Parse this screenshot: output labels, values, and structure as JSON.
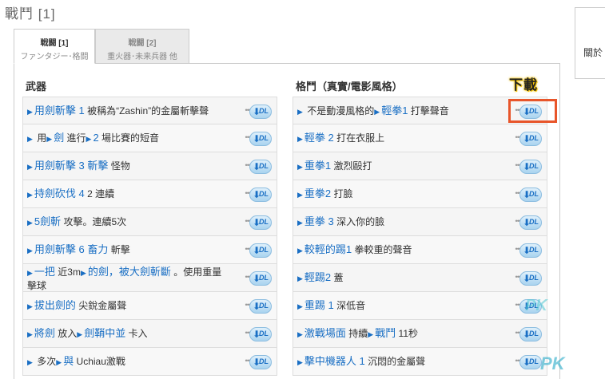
{
  "page": {
    "title": "戰鬥 [1]"
  },
  "side_box": {
    "text": "關於"
  },
  "tabs": [
    {
      "line1": "戦闘 [1]",
      "line2": "ファンタジー･格闘",
      "active": true
    },
    {
      "line1": "戦闘 [2]",
      "line2": "重火器･未来兵器 他",
      "active": false
    }
  ],
  "left_column": {
    "title": "武器",
    "rows": [
      {
        "parts": [
          [
            "a",
            ""
          ],
          [
            "b",
            "用劍斬擊 1"
          ],
          [
            "t",
            "  被稱為“Zashin”的金屬斬擊聲"
          ]
        ]
      },
      {
        "parts": [
          [
            "a",
            ""
          ],
          [
            "t",
            "  用"
          ],
          [
            "a",
            ""
          ],
          [
            "b",
            "劍"
          ],
          [
            "t",
            "  進行"
          ],
          [
            "a",
            ""
          ],
          [
            "b",
            "2"
          ],
          [
            "t",
            "  場比賽的短音"
          ]
        ]
      },
      {
        "parts": [
          [
            "a",
            ""
          ],
          [
            "b",
            "用劍斬擊 3 斬擊"
          ],
          [
            "t",
            "  怪物"
          ]
        ]
      },
      {
        "parts": [
          [
            "a",
            ""
          ],
          [
            "b",
            "持劍砍伐 4"
          ],
          [
            "t",
            "  2 連續"
          ]
        ]
      },
      {
        "parts": [
          [
            "a",
            ""
          ],
          [
            "b",
            "5劍斬"
          ],
          [
            "t",
            "  攻擊。連續5次"
          ]
        ]
      },
      {
        "parts": [
          [
            "a",
            ""
          ],
          [
            "b",
            "用劍斬擊 6 畜力"
          ],
          [
            "t",
            "  斬擊"
          ]
        ]
      },
      {
        "two_line": true,
        "parts": [
          [
            "a",
            ""
          ],
          [
            "b",
            "一把"
          ],
          [
            "t",
            "  近3m"
          ],
          [
            "a",
            ""
          ],
          [
            "b",
            "的劍，被大劍斬斷"
          ],
          [
            "t",
            "  。使用重量擊球"
          ]
        ]
      },
      {
        "parts": [
          [
            "a",
            ""
          ],
          [
            "b",
            "拔出劍的"
          ],
          [
            "t",
            "  尖銳金屬聲"
          ]
        ]
      },
      {
        "parts": [
          [
            "a",
            ""
          ],
          [
            "b",
            "將劍"
          ],
          [
            "t",
            "  放入"
          ],
          [
            "a",
            ""
          ],
          [
            "b",
            "劍鞘中並"
          ],
          [
            "t",
            "  卡入"
          ]
        ]
      },
      {
        "parts": [
          [
            "a",
            ""
          ],
          [
            "t",
            "  多次"
          ],
          [
            "a",
            ""
          ],
          [
            "b",
            "與"
          ],
          [
            "t",
            "  Uchiau激戰"
          ]
        ]
      }
    ]
  },
  "right_column": {
    "title": "格鬥（真實/電影風格）",
    "rows": [
      {
        "parts": [
          [
            "a",
            ""
          ],
          [
            "t",
            "  不是動漫風格的"
          ],
          [
            "a",
            ""
          ],
          [
            "b",
            "輕拳1"
          ],
          [
            "t",
            "  打擊聲音"
          ]
        ]
      },
      {
        "parts": [
          [
            "a",
            ""
          ],
          [
            "b",
            "輕拳 2"
          ],
          [
            "t",
            "  打在衣服上"
          ]
        ]
      },
      {
        "parts": [
          [
            "a",
            ""
          ],
          [
            "b",
            "重拳1"
          ],
          [
            "t",
            "  激烈毆打"
          ]
        ]
      },
      {
        "parts": [
          [
            "a",
            ""
          ],
          [
            "b",
            "重拳2"
          ],
          [
            "t",
            "  打臉"
          ]
        ]
      },
      {
        "parts": [
          [
            "a",
            ""
          ],
          [
            "b",
            "重拳 3"
          ],
          [
            "t",
            "  深入你的臉"
          ]
        ]
      },
      {
        "parts": [
          [
            "a",
            ""
          ],
          [
            "b",
            "較輕的踢1"
          ],
          [
            "t",
            "  拳較重的聲音"
          ]
        ]
      },
      {
        "parts": [
          [
            "a",
            ""
          ],
          [
            "b",
            "輕踢2"
          ],
          [
            "t",
            "  蓋"
          ]
        ]
      },
      {
        "parts": [
          [
            "a",
            ""
          ],
          [
            "b",
            "重踢 1"
          ],
          [
            "t",
            "  深低音"
          ]
        ]
      },
      {
        "parts": [
          [
            "a",
            ""
          ],
          [
            "b",
            "激戰場面"
          ],
          [
            "t",
            "  持續"
          ],
          [
            "a",
            ""
          ],
          [
            "b",
            "戰鬥"
          ],
          [
            "t",
            "  11秒"
          ]
        ]
      },
      {
        "parts": [
          [
            "a",
            ""
          ],
          [
            "b",
            "擊中機器人 1"
          ],
          [
            "t",
            "  沉悶的金屬聲"
          ]
        ]
      }
    ]
  },
  "download": {
    "label": "DL",
    "dots": "•••",
    "arrow": "⬇"
  },
  "annotation": {
    "text": "下載"
  },
  "watermark": {
    "a": "PK",
    "b": "PK"
  },
  "colors": {
    "link_blue": "#1a6fc4",
    "highlight": "#e8552a",
    "annotation_glow": "#f6c400"
  }
}
